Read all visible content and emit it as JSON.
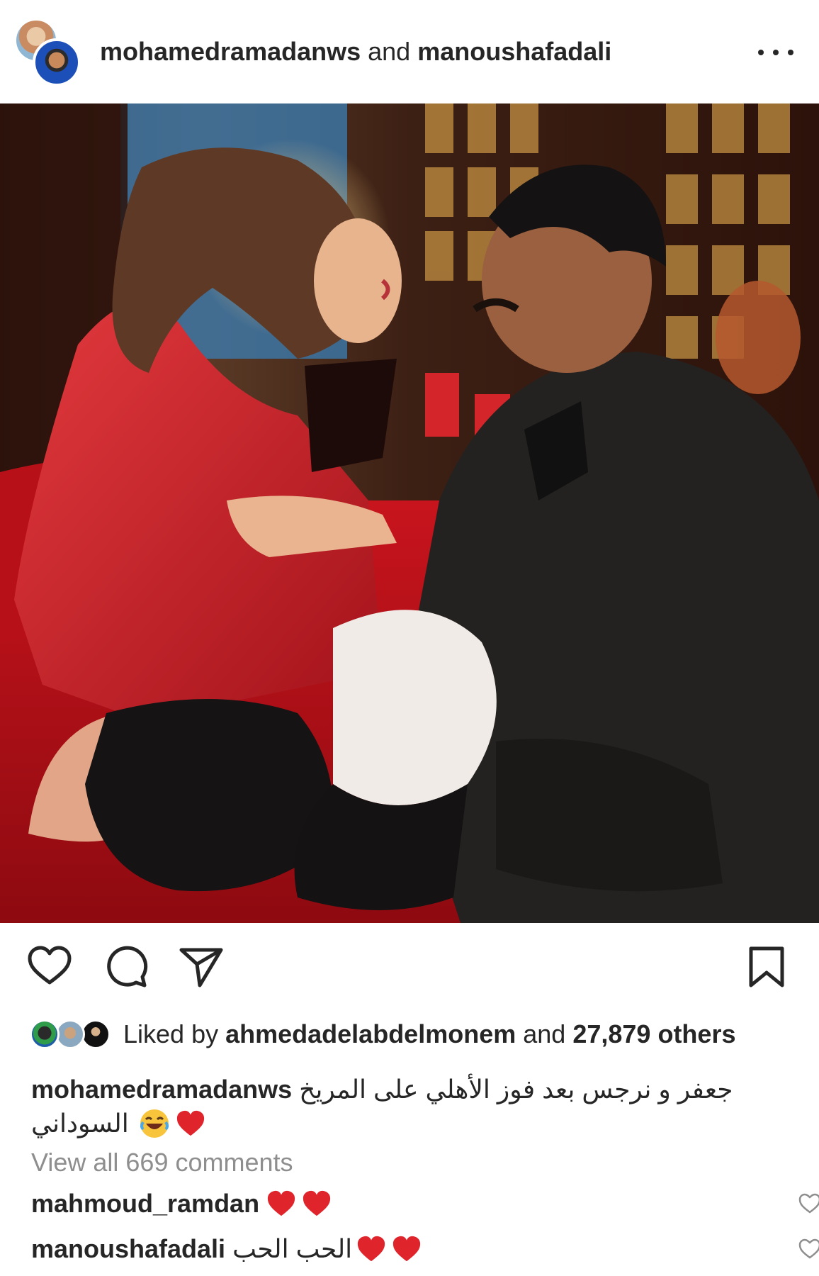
{
  "post": {
    "header": {
      "user1": "mohamedramadanws",
      "connector": "and",
      "user2": "manoushafadali",
      "more_icon": "more-horizontal-icon"
    },
    "photo": {
      "description_icon": "post-photo"
    },
    "actions": {
      "like_icon": "heart-outline-icon",
      "comment_icon": "comment-bubble-icon",
      "share_icon": "paper-plane-icon",
      "save_icon": "bookmark-outline-icon"
    },
    "likes": {
      "prefix": "Liked by",
      "user": "ahmedadelabdelmonem",
      "middle": "and",
      "count": "27,879 others"
    },
    "caption": {
      "user": "mohamedramadanws",
      "text_line1": "جعفر و نرجس بعد فوز الأهلي على المريخ",
      "text_line2": "السوداني"
    },
    "view_all_comments": "View all 669 comments",
    "comments": [
      {
        "user": "mahmoud_ramdan",
        "text": ""
      },
      {
        "user": "manoushafadali",
        "text": "الحب الحب"
      }
    ],
    "colors": {
      "text": "#262626",
      "muted": "#8e8e8e",
      "heart_red": "#e0242b"
    }
  }
}
